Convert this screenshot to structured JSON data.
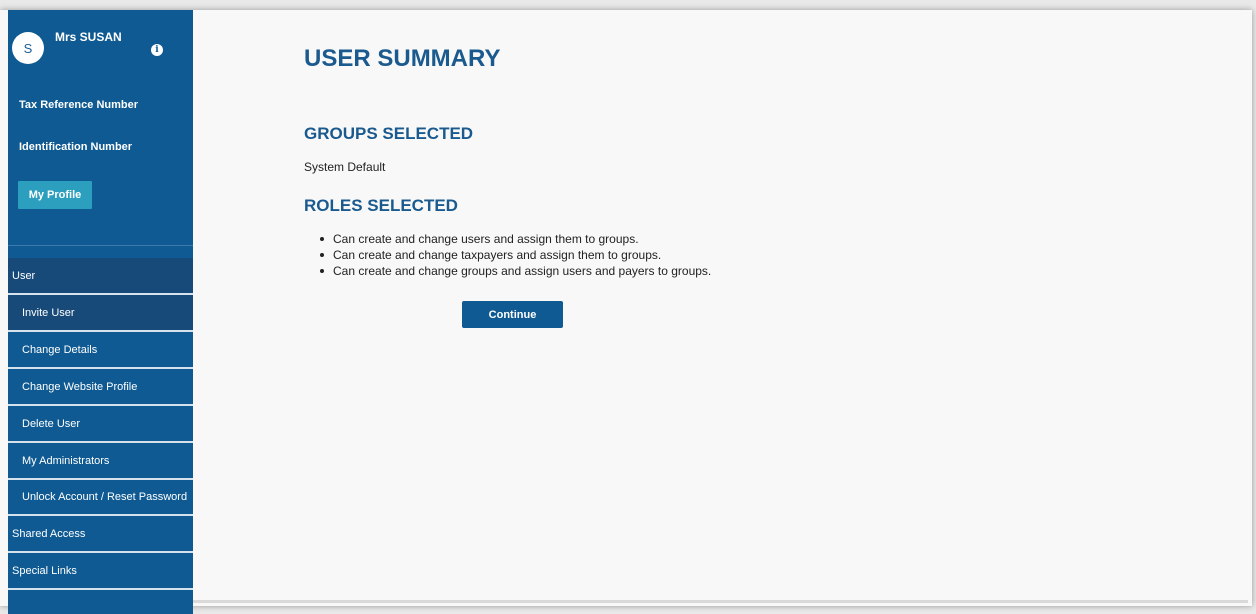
{
  "sidebar": {
    "avatar_initial": "S",
    "user_name": "Mrs SUSAN",
    "info_icon": "i",
    "tax_reference_label": "Tax Reference Number",
    "identification_label": "Identification Number",
    "profile_button": "My Profile",
    "nav": [
      {
        "label": "User"
      },
      {
        "label": "Invite User"
      },
      {
        "label": "Change Details"
      },
      {
        "label": "Change Website Profile"
      },
      {
        "label": "Delete User"
      },
      {
        "label": "My Administrators"
      },
      {
        "label": "Unlock Account / Reset Password"
      },
      {
        "label": "Shared Access"
      },
      {
        "label": "Special Links"
      }
    ]
  },
  "main": {
    "title": "USER SUMMARY",
    "groups_heading": "GROUPS SELECTED",
    "group_value": "System Default",
    "roles_heading": "ROLES SELECTED",
    "roles": [
      "Can create and change users and assign them to groups.",
      "Can create and change taxpayers and assign them to groups.",
      "Can create and change groups and assign users and payers to groups."
    ],
    "continue_label": "Continue"
  },
  "colors": {
    "sidebar_bg": "#0f5a92",
    "sidebar_active": "#174a78",
    "accent_button": "#2b9fbd",
    "heading": "#1a5a8e"
  }
}
